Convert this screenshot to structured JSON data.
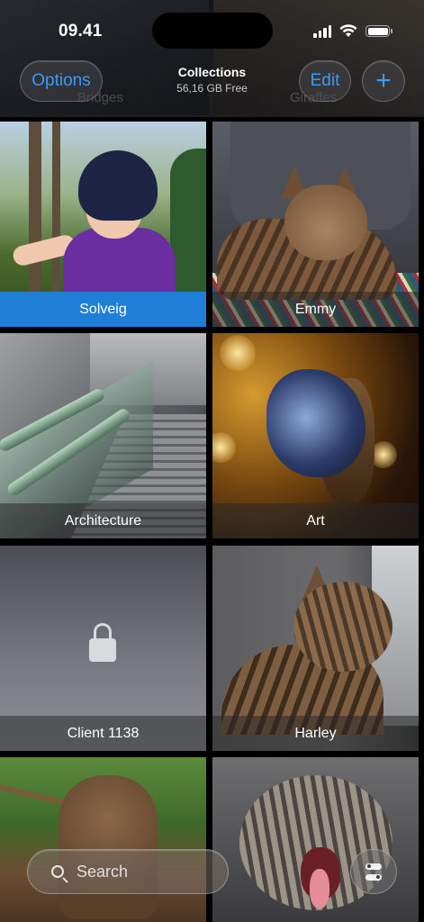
{
  "status_bar": {
    "time": "09.41"
  },
  "header": {
    "title": "Collections",
    "subtitle": "56,16 GB Free",
    "options_label": "Options",
    "edit_label": "Edit",
    "add_label": "+",
    "behind_labels": [
      "Bridges",
      "Giraffes"
    ]
  },
  "collections": [
    {
      "name": "Solveig"
    },
    {
      "name": "Emmy"
    },
    {
      "name": "Architecture"
    },
    {
      "name": "Art"
    },
    {
      "name": "Client 1138",
      "locked": true
    },
    {
      "name": "Harley"
    }
  ],
  "search": {
    "placeholder": "Search"
  },
  "colors": {
    "accent": "#3a9bf5",
    "selected_caption": "#1f7fd6"
  },
  "icons": [
    "search-icon",
    "lock-icon",
    "plus-icon",
    "filter-toggle-icon",
    "wifi-icon",
    "cellular-signal-icon",
    "battery-icon"
  ]
}
